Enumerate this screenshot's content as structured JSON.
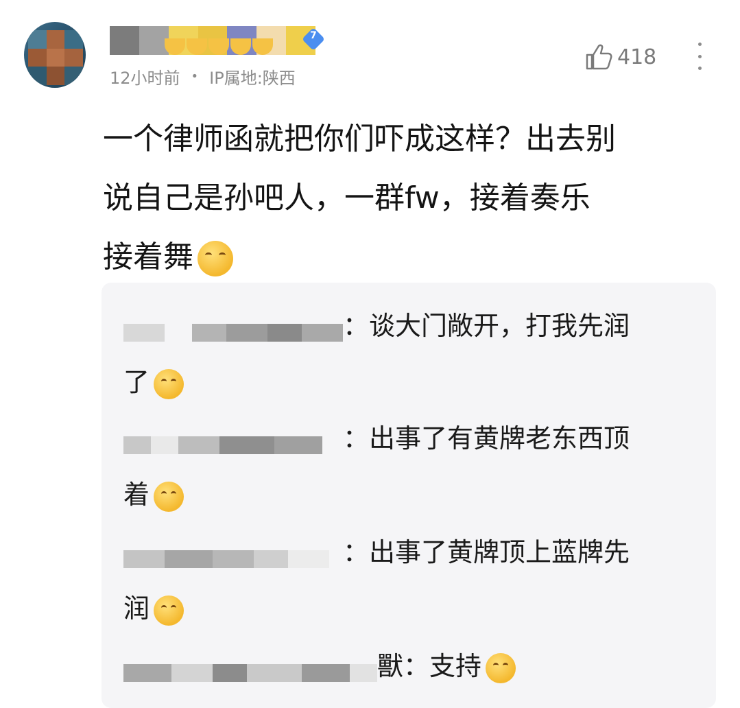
{
  "comment": {
    "time": "12小时前",
    "separator": "•",
    "ip": "IP属地:陕西",
    "level": "7",
    "likes": "418",
    "text_line1": "一个律师函就把你们吓成这样？出去别",
    "text_line2": "说自己是孙吧人，一群fw，接着奏乐",
    "text_line3": "接着舞"
  },
  "replies": [
    {
      "name_suffix": "：",
      "text_a": "谈大门敞开，打我先润",
      "text_b": "了",
      "emoji": "laughing-face"
    },
    {
      "name_suffix": "：",
      "text_a": "出事了有黄牌老东西顶",
      "text_b": "着",
      "emoji": "yum-face"
    },
    {
      "name_suffix": "：",
      "text_a": "出事了黄牌顶上蓝牌先",
      "text_b": "润",
      "emoji": "smiling-face"
    },
    {
      "name_suffix": "獸：",
      "text_a": "支持",
      "text_b": "",
      "emoji": "angry-face"
    }
  ],
  "colors": {
    "meta_gray": "#8c8c8c",
    "reply_bg": "#f5f5f7",
    "emoji_yellow": "#f5c244",
    "badge_blue": "#4b8ef0"
  }
}
